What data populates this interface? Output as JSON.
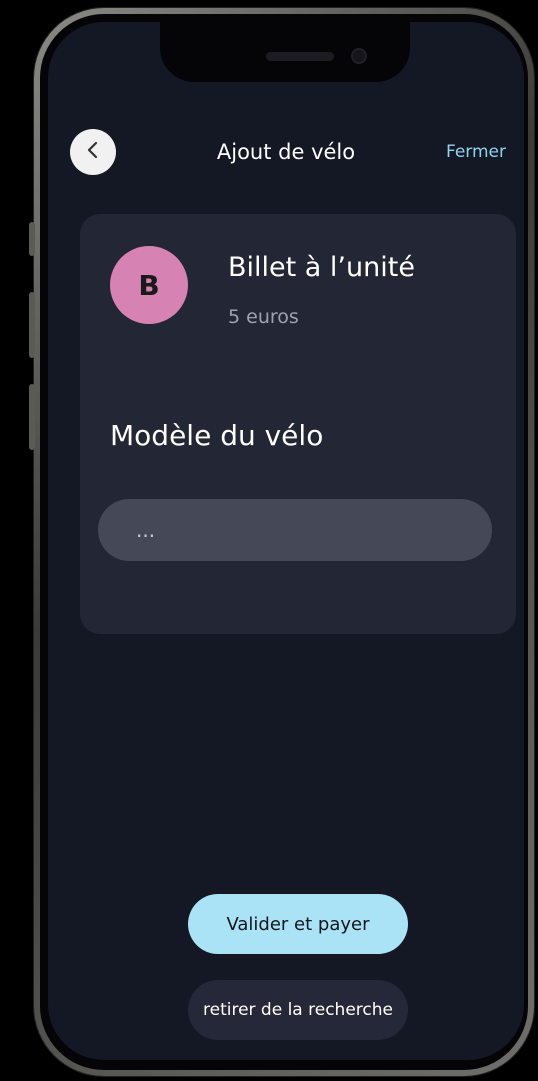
{
  "header": {
    "title": "Ajout de vélo",
    "close_label": "Fermer",
    "back_icon": "chevron-left-icon"
  },
  "ticket": {
    "avatar_letter": "B",
    "title": "Billet à l’unité",
    "price": "5 euros"
  },
  "form": {
    "model_label": "Modèle du vélo",
    "model_value": "..."
  },
  "actions": {
    "primary_label": "Valider et payer",
    "secondary_label": "retirer de la recherche"
  },
  "colors": {
    "background": "#141825",
    "card": "#222635",
    "accent": "#a9e3f5",
    "link": "#8fd4ec",
    "avatar": "#d683b4"
  }
}
